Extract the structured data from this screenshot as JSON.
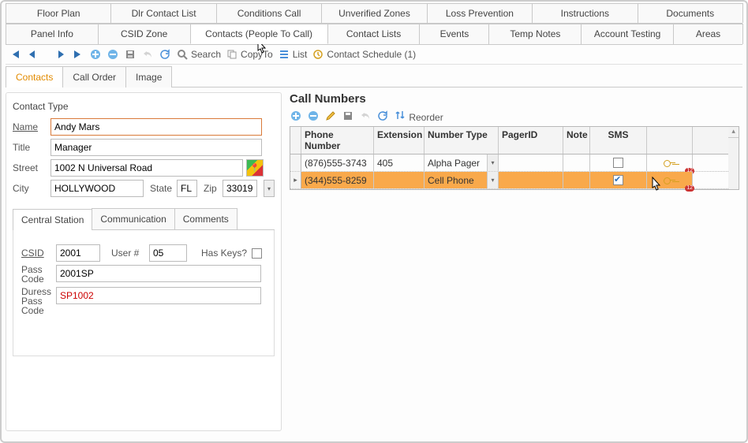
{
  "topTabs1": [
    "Floor Plan",
    "Dlr Contact List",
    "Conditions Call",
    "Unverified Zones",
    "Loss Prevention",
    "Instructions",
    "Documents"
  ],
  "topTabs2": [
    "Panel Info",
    "CSID Zone",
    "Contacts (People To Call)",
    "Contact Lists",
    "Events",
    "Temp Notes",
    "Account Testing",
    "Areas"
  ],
  "topTabs2_active": 2,
  "toolbar": {
    "search": "Search",
    "copyto": "CopyTo",
    "list": "List",
    "schedule": "Contact Schedule (1)"
  },
  "subTabs": [
    "Contacts",
    "Call Order",
    "Image"
  ],
  "subTabs_active": 0,
  "contact": {
    "sectionTitle": "Contact Type",
    "labels": {
      "name": "Name",
      "title": "Title",
      "street": "Street",
      "city": "City",
      "state": "State",
      "zip": "Zip"
    },
    "name": "Andy Mars",
    "title": "Manager",
    "street": "1002 N Universal Road",
    "city": "HOLLYWOOD",
    "state": "FL",
    "zip": "33019"
  },
  "innerTabs": [
    "Central Station",
    "Communication",
    "Comments"
  ],
  "innerTabs_active": 0,
  "central": {
    "labels": {
      "csid": "CSID",
      "usernum": "User #",
      "haskeys": "Has Keys?",
      "passcode": "Pass Code",
      "duress": "Duress Pass Code"
    },
    "csid": "2001",
    "usernum": "05",
    "passcode": "2001SP",
    "duress": "SP1002",
    "haskeys": false
  },
  "callNumbers": {
    "title": "Call Numbers",
    "reorder": "Reorder",
    "headers": [
      "Phone Number",
      "Extension",
      "Number Type",
      "PagerID",
      "Note",
      "SMS"
    ],
    "rows": [
      {
        "phone": "(876)555-3743",
        "ext": "405",
        "type": "Alpha Pager",
        "pager": "",
        "note": "",
        "sms": false,
        "selected": false
      },
      {
        "phone": "(344)555-8259",
        "ext": "",
        "type": "Cell Phone",
        "pager": "",
        "note": "",
        "sms": true,
        "selected": true
      }
    ],
    "badge": "12"
  }
}
